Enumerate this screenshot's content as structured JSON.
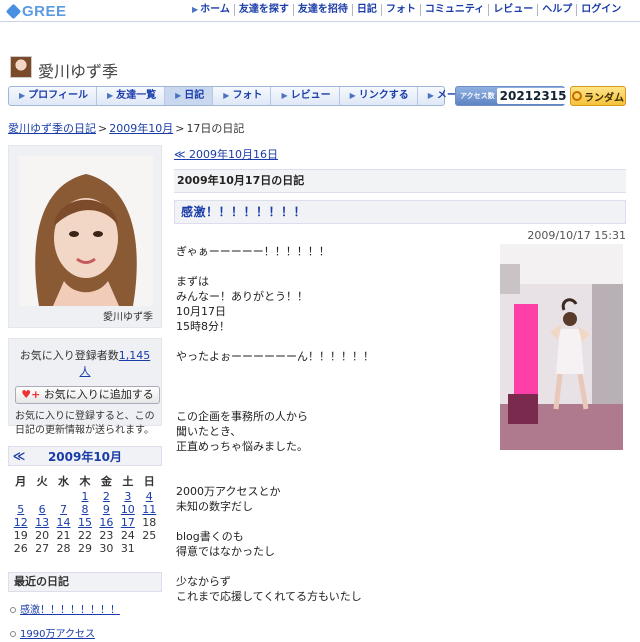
{
  "brand": {
    "logo_text": "GREE"
  },
  "top_nav": [
    {
      "label": "ホーム"
    },
    {
      "label": "友達を探す"
    },
    {
      "label": "友達を招待"
    },
    {
      "label": "日記"
    },
    {
      "label": "フォト"
    },
    {
      "label": "コミュニティ"
    },
    {
      "label": "レビュー"
    },
    {
      "label": "ヘルプ"
    },
    {
      "label": "ログイン"
    }
  ],
  "profile": {
    "name": "愛川ゆず季"
  },
  "sub_nav": [
    {
      "label": "プロフィール"
    },
    {
      "label": "友達一覧"
    },
    {
      "label": "日記"
    },
    {
      "label": "フォト"
    },
    {
      "label": "レビュー"
    },
    {
      "label": "リンクする"
    },
    {
      "label": "メールを送る"
    }
  ],
  "access": {
    "label": "アクセス数",
    "count": "20212315"
  },
  "random_button": {
    "label": "ランダム"
  },
  "breadcrumb": {
    "diary": "愛川ゆず季の日記",
    "month": "2009年10月",
    "current": "17日の日記"
  },
  "photo_box": {
    "name": "愛川ゆず季"
  },
  "favorites": {
    "count_label": "お気に入り登録者数",
    "count": "1,145人",
    "add_button": "お気に入りに追加する",
    "description": "お気に入りに登録すると、この日記の更新情報が送られます。"
  },
  "calendar": {
    "prev": "≪",
    "title": "2009年10月",
    "weekdays": [
      "月",
      "火",
      "水",
      "木",
      "金",
      "土",
      "日"
    ],
    "weeks": [
      [
        "",
        "",
        "",
        "1",
        "2",
        "3",
        "4"
      ],
      [
        "5",
        "6",
        "7",
        "8",
        "9",
        "10",
        "11"
      ],
      [
        "12",
        "13",
        "14",
        "15",
        "16",
        "17",
        "18"
      ],
      [
        "19",
        "20",
        "21",
        "22",
        "23",
        "24",
        "25"
      ],
      [
        "26",
        "27",
        "28",
        "29",
        "30",
        "31",
        ""
      ]
    ],
    "linked_days": [
      "1",
      "2",
      "3",
      "4",
      "5",
      "6",
      "7",
      "8",
      "9",
      "10",
      "11",
      "12",
      "13",
      "14",
      "15",
      "16",
      "17"
    ]
  },
  "recent": {
    "title": "最近の日記",
    "items": [
      {
        "label": "感激！！！！！！！！"
      },
      {
        "label": "1990万アクセス"
      }
    ]
  },
  "entry": {
    "prev_link": "≪ 2009年10月16日",
    "date_heading": "2009年10月17日の日記",
    "title": "感激！！！！！！！！",
    "timestamp": "2009/10/17 15:31",
    "body_lines": [
      "ぎゃぁーーーーー！！！！！！",
      "",
      "まずは",
      "みんなー！ありがとう！！",
      "10月17日",
      "15時8分！",
      "",
      "やったよぉーーーーーーん！！！！！！",
      "",
      "",
      "",
      "この企画を事務所の人から",
      "聞いたとき、",
      "正直めっちゃ悩みました。",
      "",
      "",
      "2000万アクセスとか",
      "未知の数字だし",
      "",
      "blog書くのも",
      "得意ではなかったし",
      "",
      "少なからず",
      "これまで応援してくれてる方もいたし"
    ]
  }
}
